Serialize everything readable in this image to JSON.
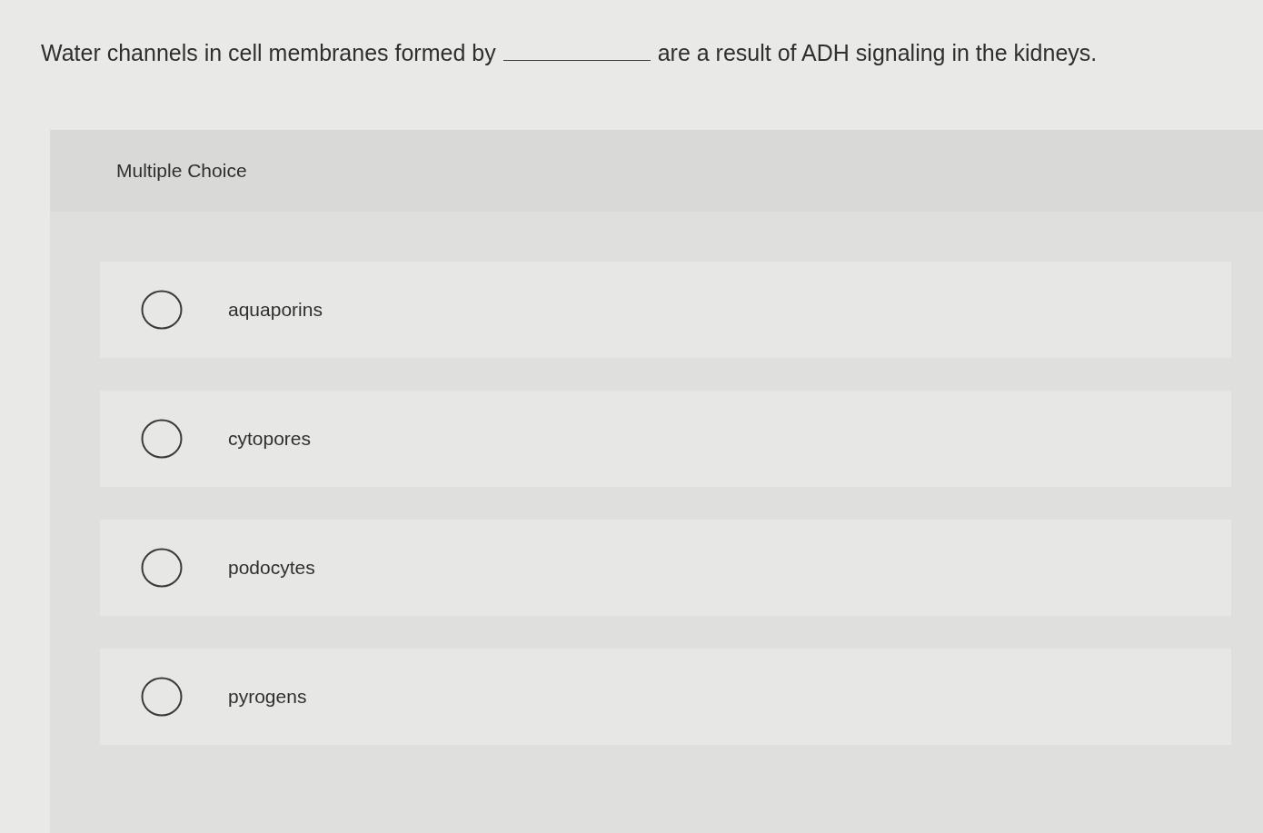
{
  "question": {
    "text_before": "Water channels in cell membranes formed by",
    "text_after": "are a result of ADH signaling in the kidneys."
  },
  "answer_panel": {
    "heading": "Multiple Choice",
    "options": [
      {
        "label": "aquaporins",
        "selected": false
      },
      {
        "label": "cytopores",
        "selected": false
      },
      {
        "label": "podocytes",
        "selected": false
      },
      {
        "label": "pyrogens",
        "selected": false
      }
    ]
  }
}
